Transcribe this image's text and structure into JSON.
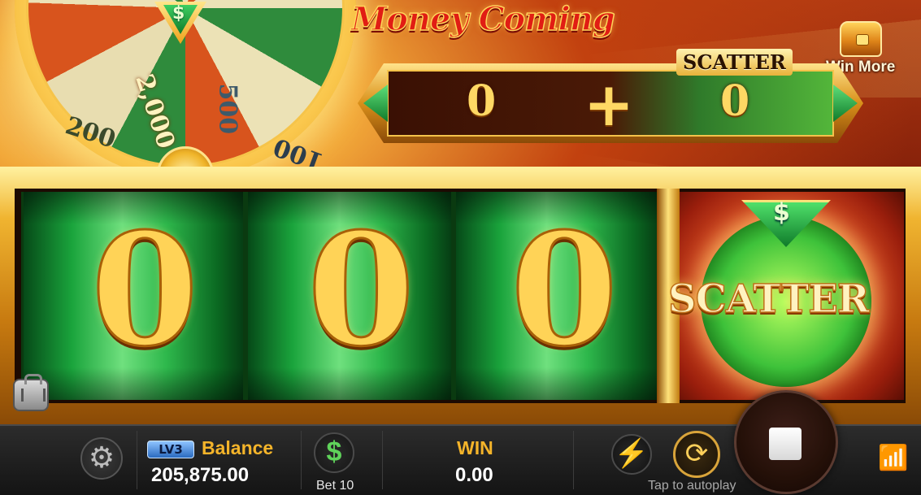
{
  "game": {
    "title": "Money Coming",
    "win_more_label": "Win More"
  },
  "wheel": {
    "pointer_symbol": "$",
    "segments": [
      "2,000",
      "200",
      "500",
      "100"
    ]
  },
  "counter": {
    "left_value": "0",
    "operator": "+",
    "right_value": "0",
    "scatter_tag": "SCATTER"
  },
  "reels": {
    "digits": [
      "0",
      "0",
      "0"
    ],
    "special_symbol": "SCATTER",
    "special_symbol_sign": "$"
  },
  "bottom_bar": {
    "level_badge": "LV3",
    "balance_label": "Balance",
    "balance_value": "205,875.00",
    "bet_symbol": "$",
    "bet_label": "Bet 10",
    "win_label": "WIN",
    "win_value": "0.00",
    "autoplay_hint": "Tap to autoplay"
  },
  "icons": {
    "settings": "gear-icon",
    "turbo": "lightning-icon",
    "autoplay": "autoplay-icon",
    "stop": "stop-icon",
    "wifi": "wifi-icon",
    "bag": "bag-icon",
    "chest": "treasure-chest-icon"
  },
  "colors": {
    "accent_gold": "#f4b42a",
    "reel_green": "#1aa43c",
    "title_red": "#e11d14",
    "wifi_green": "#46d34a"
  }
}
